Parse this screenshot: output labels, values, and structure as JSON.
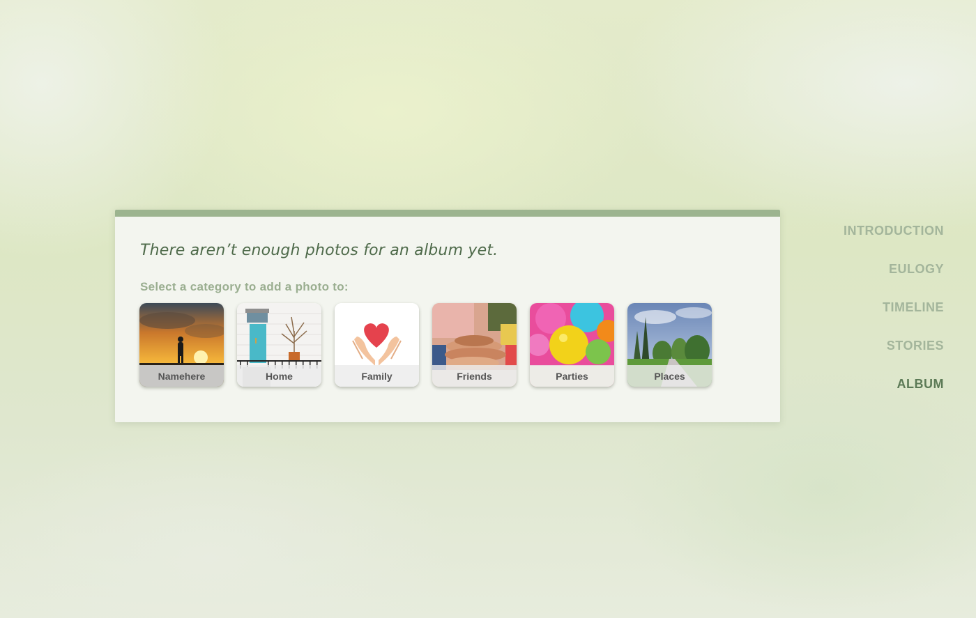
{
  "panel": {
    "headline": "There aren’t enough photos for an album yet.",
    "prompt": "Select a category to add a photo to:"
  },
  "categories": [
    {
      "label": "Namehere",
      "icon": "sunset-child-photo"
    },
    {
      "label": "Home",
      "icon": "house-door-photo"
    },
    {
      "label": "Family",
      "icon": "heart-hands-icon"
    },
    {
      "label": "Friends",
      "icon": "stacked-hands-photo"
    },
    {
      "label": "Parties",
      "icon": "balloons-photo"
    },
    {
      "label": "Places",
      "icon": "park-path-photo"
    }
  ],
  "nav": {
    "items": [
      "INTRODUCTION",
      "EULOGY",
      "TIMELINE",
      "STORIES",
      "ALBUM"
    ],
    "active": "ALBUM"
  },
  "colors": {
    "accent_bar": "#9cb48f",
    "headline": "#4e6a4a",
    "prompt": "#9aae90",
    "nav_inactive": "#a3b59b",
    "nav_active": "#5c7a56"
  }
}
